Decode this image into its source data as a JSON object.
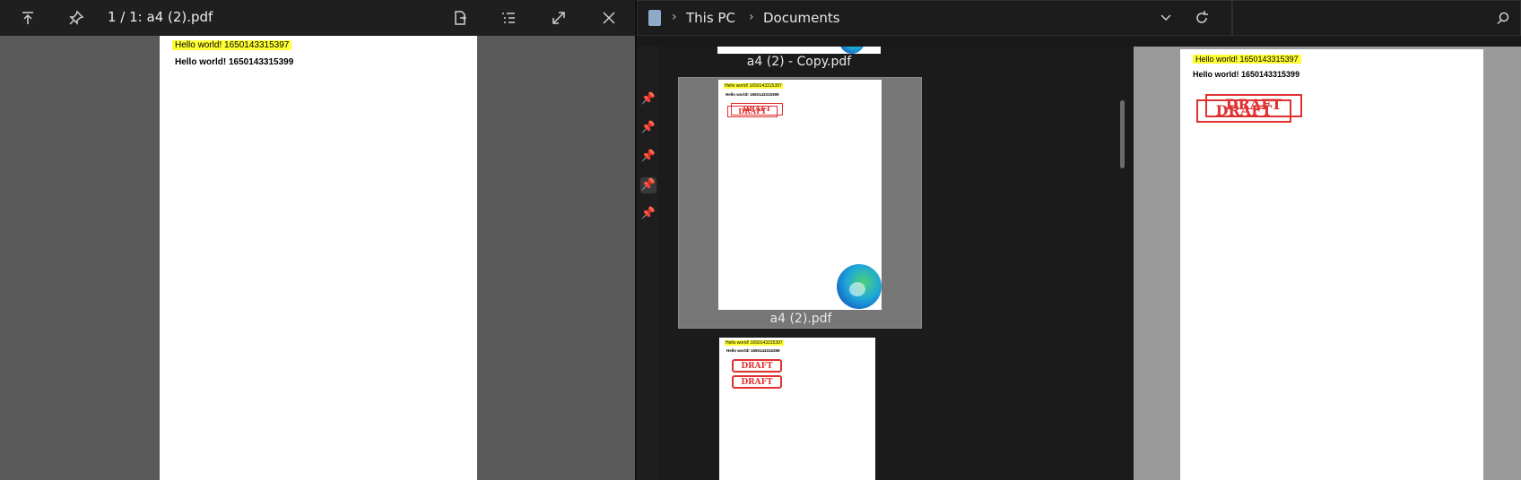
{
  "viewer": {
    "title": "1 / 1: a4 (2).pdf",
    "page_lines": [
      "Hello world! 1650143315397",
      "Hello world! 1650143315399"
    ]
  },
  "explorer": {
    "breadcrumb": [
      "This PC",
      "Documents"
    ],
    "search_placeholder": "",
    "files": [
      {
        "name": "a4 (2) - Copy.pdf"
      },
      {
        "name": "a4 (2).pdf",
        "selected": true
      },
      {
        "name": ""
      }
    ],
    "thumb_lines": [
      "Hello world! 1650143315397",
      "Hello world! 1650143315399"
    ],
    "stamp_text": "DRAFT"
  },
  "preview": {
    "lines": [
      "Hello world! 1650143315397",
      "Hello world! 1650143315399"
    ],
    "stamp_text": "DRAFT"
  },
  "colors": {
    "highlight": "#ffff33",
    "stamp": "#e03030",
    "accent": "#1fa7d9"
  }
}
